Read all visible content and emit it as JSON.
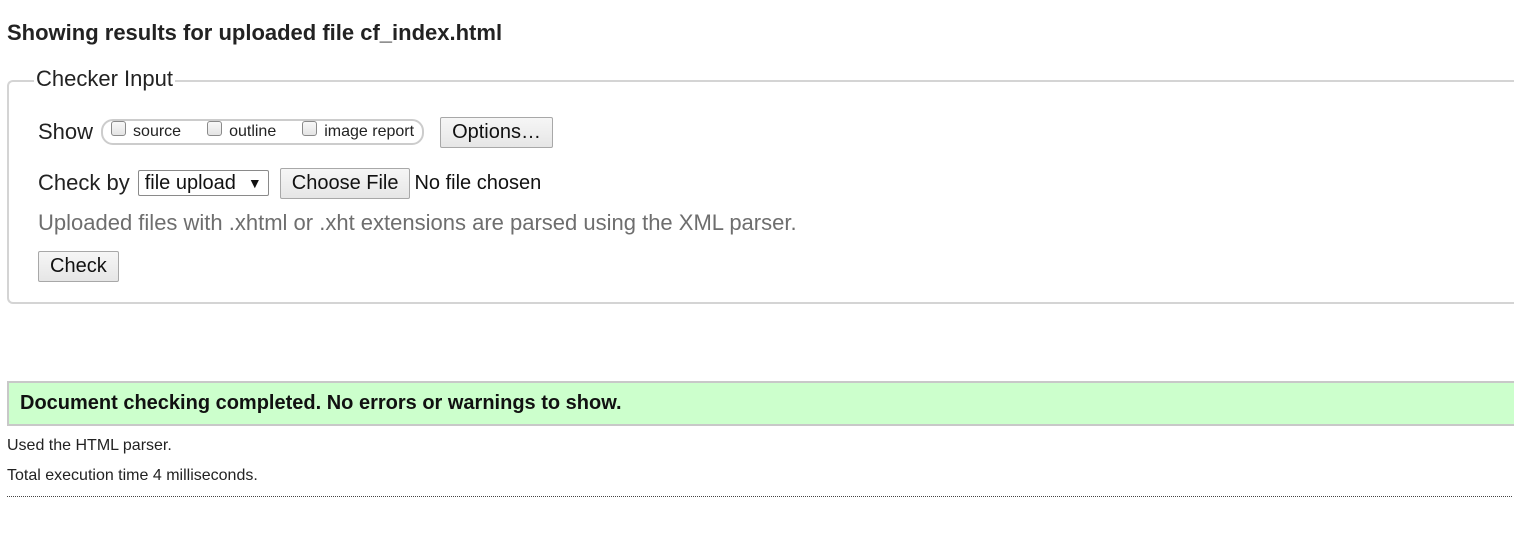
{
  "heading": "Showing results for uploaded file cf_index.html",
  "checker_input": {
    "legend": "Checker Input",
    "show_label": "Show",
    "show_options": [
      {
        "label": "source",
        "checked": false
      },
      {
        "label": "outline",
        "checked": false
      },
      {
        "label": "image report",
        "checked": false
      }
    ],
    "options_button": "Options…",
    "check_by_label": "Check by",
    "check_by_selected": "file upload",
    "choose_file_button": "Choose File",
    "file_status": "No file chosen",
    "hint": "Uploaded files with .xhtml or .xht extensions are parsed using the XML parser.",
    "check_button": "Check"
  },
  "result": {
    "success_message": "Document checking completed. No errors or warnings to show.",
    "parser_info": "Used the HTML parser.",
    "execution_time": "Total execution time 4 milliseconds."
  },
  "colors": {
    "success_bg": "#ccffcc",
    "hint_text": "#6e6e6e"
  }
}
